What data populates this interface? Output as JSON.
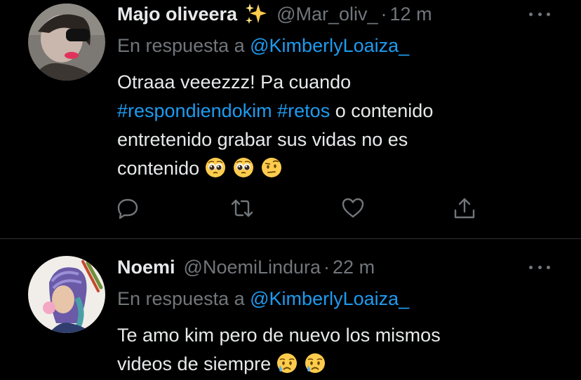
{
  "colors": {
    "background": "#000000",
    "text": "#e7e9ea",
    "muted": "#71767b",
    "accent": "#1d9bf0",
    "divider": "#2f3336"
  },
  "tweets": [
    {
      "display_name": "Majo oliveera",
      "name_emoji": "sparkles-emoji",
      "handle": "@Mar_oliv_",
      "separator": "·",
      "time": "12 m",
      "reply_prefix": "En respuesta a",
      "reply_mention": "@KimberlyLoaiza_",
      "text_line1": "Otraaa veeezzz! Pa cuando",
      "hashtag1": "#respondiendokim",
      "hashtag2": "#retos",
      "text_line2_rest": "o contenido",
      "text_line3": "entretenido grabar sus vidas no es",
      "text_line4": "contenido",
      "emojis": [
        "pleading-face-emoji",
        "pleading-face-emoji",
        "face-with-raised-eyebrow-emoji"
      ],
      "actions": [
        "reply-icon",
        "retweet-icon",
        "like-icon",
        "share-icon"
      ]
    },
    {
      "display_name": "Noemi",
      "handle": "@NoemiLindura",
      "separator": "·",
      "time": "22 m",
      "reply_prefix": "En respuesta a",
      "reply_mention": "@KimberlyLoaiza_",
      "text_line1": "Te amo kim pero de nuevo los mismos",
      "text_line2": "videos de siempre",
      "emojis": [
        "sad-but-relieved-face-emoji",
        "sad-but-relieved-face-emoji"
      ]
    }
  ]
}
